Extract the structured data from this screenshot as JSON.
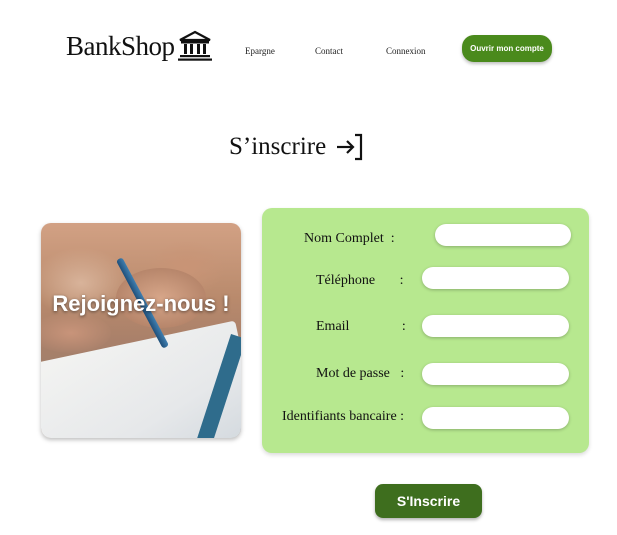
{
  "header": {
    "brand": "BankShop",
    "brand_icon": "bank-icon",
    "nav": [
      {
        "label": "Epargne"
      },
      {
        "label": "Contact"
      },
      {
        "label": "Connexion"
      }
    ],
    "cta_label": "Ouvrir mon compte",
    "accent_color": "#4a8a1c"
  },
  "page": {
    "title": "S’inscrire",
    "title_icon": "login-icon"
  },
  "hero": {
    "overlay_text": "Rejoignez-nous !"
  },
  "form": {
    "background": "#b7e88f",
    "fields": [
      {
        "label": "Nom Complet  :",
        "value": ""
      },
      {
        "label": "Téléphone       :",
        "value": ""
      },
      {
        "label": "Email               :",
        "value": ""
      },
      {
        "label": "Mot de passe   :",
        "value": ""
      },
      {
        "label": "Identifiants bancaire :",
        "value": ""
      }
    ],
    "submit_label": "S'Inscrire",
    "submit_color": "#3e6e1e"
  }
}
